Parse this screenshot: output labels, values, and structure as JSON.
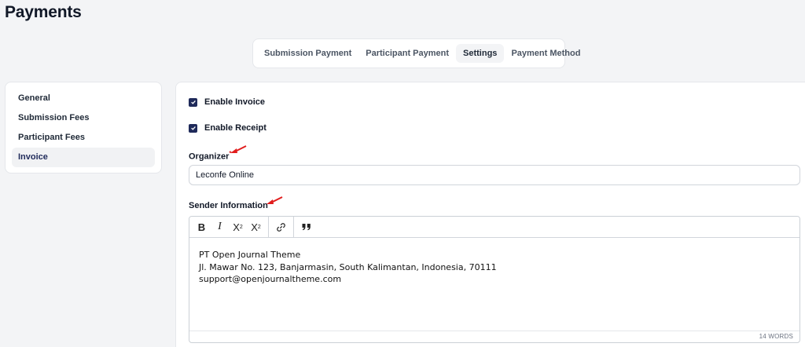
{
  "page": {
    "title": "Payments"
  },
  "tabs": [
    {
      "label": "Submission Payment",
      "active": false
    },
    {
      "label": "Participant Payment",
      "active": false
    },
    {
      "label": "Settings",
      "active": true
    },
    {
      "label": "Payment Method",
      "active": false
    }
  ],
  "sidebar": {
    "items": [
      {
        "label": "General"
      },
      {
        "label": "Submission Fees"
      },
      {
        "label": "Participant Fees"
      },
      {
        "label": "Invoice",
        "active": true
      }
    ]
  },
  "form": {
    "enable_invoice": {
      "label": "Enable Invoice",
      "checked": true
    },
    "enable_receipt": {
      "label": "Enable Receipt",
      "checked": true
    },
    "organizer": {
      "label": "Organizer",
      "required_mark": "*",
      "value": "Leconfe Online"
    },
    "sender_information": {
      "label": "Sender Information",
      "toolbar": {
        "bold": "B",
        "italic": "I",
        "superscript": "X",
        "sup_mark": "2",
        "subscript": "X",
        "sub_mark": "2"
      },
      "lines": [
        "PT Open Journal Theme",
        "Jl. Mawar No. 123, Banjarmasin, South Kalimantan, Indonesia, 70111",
        "support@openjournaltheme.com"
      ],
      "word_count": "14 WORDS"
    }
  },
  "colors": {
    "accent": "#1f2a5a",
    "annotation_arrow": "#e11d1d",
    "required": "#dc2626"
  }
}
